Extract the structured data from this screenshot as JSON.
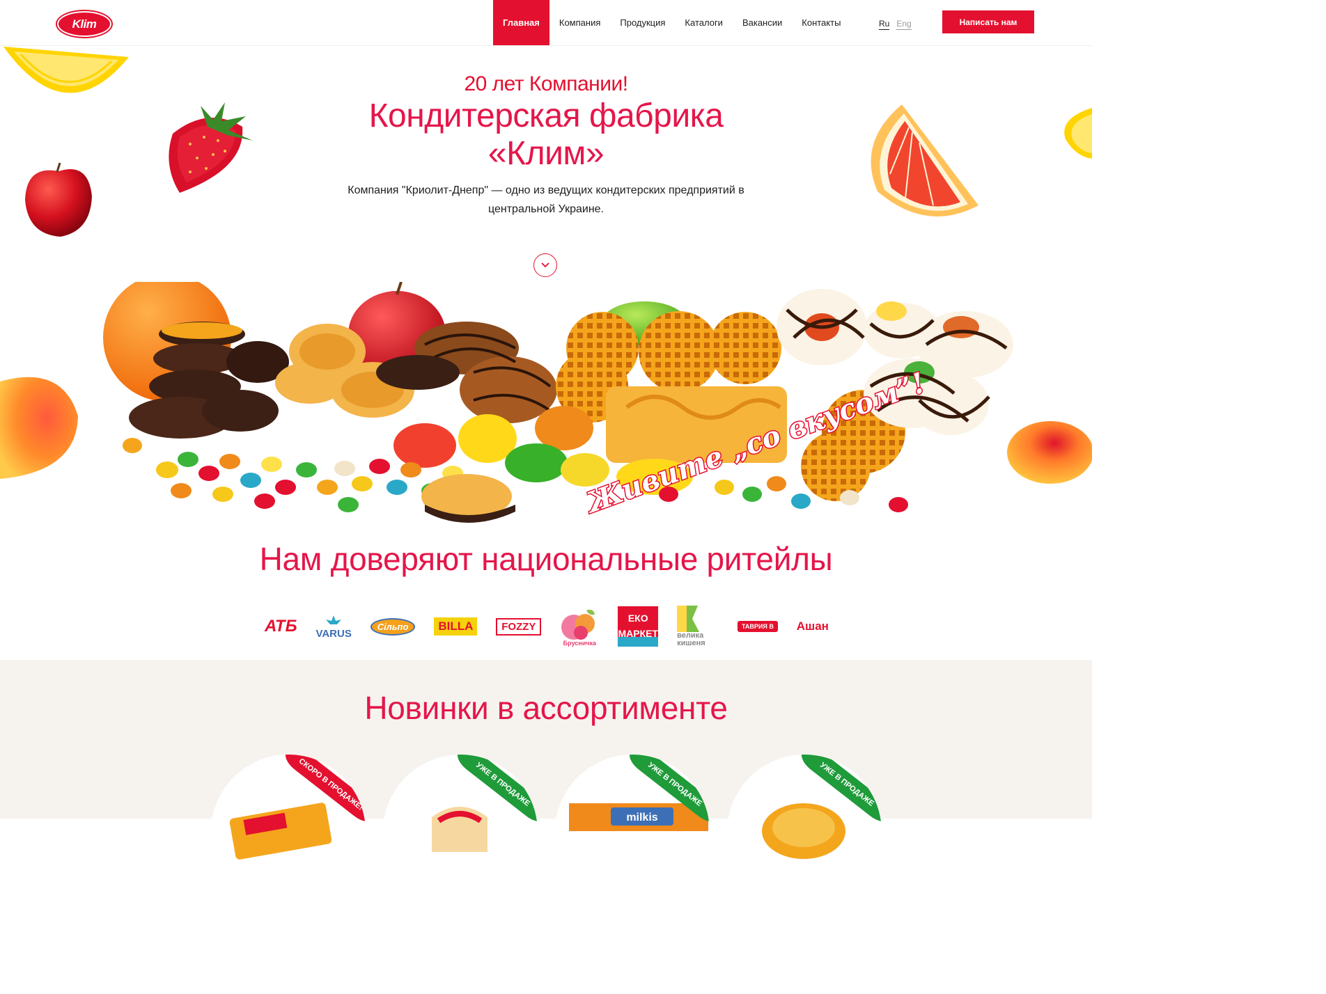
{
  "brand": {
    "logo_text": "Klim",
    "accent": "#e4102f"
  },
  "nav": {
    "items": [
      {
        "label": "Главная",
        "active": true
      },
      {
        "label": "Компания",
        "active": false
      },
      {
        "label": "Продукция",
        "active": false
      },
      {
        "label": "Каталоги",
        "active": false
      },
      {
        "label": "Вакансии",
        "active": false
      },
      {
        "label": "Контакты",
        "active": false
      }
    ]
  },
  "lang": {
    "ru": "Ru",
    "en": "Eng",
    "active": "Ru"
  },
  "header": {
    "cta_label": "Написать нам"
  },
  "hero": {
    "subtitle": "20 лет Компании!",
    "title": "Кондитерская фабрика «Клим»",
    "description": "Компания \"Криолит-Днепр\" — одно из ведущих кондитерских предприятий в центральной Украине.",
    "slogan": "Живите „со вкусом”!"
  },
  "retail": {
    "title": "Нам доверяют национальные ритейлы",
    "logos": [
      {
        "text": "АТБ",
        "color": "#e4102f",
        "icon": "atb-logo"
      },
      {
        "text": "VARUS",
        "color": "#3d6fb6",
        "icon": "varus-logo"
      },
      {
        "text": "Сільпо",
        "color": "#f4a11d",
        "icon": "silpo-logo"
      },
      {
        "text": "BILLA",
        "color": "#f5d20a",
        "icon": "billa-logo"
      },
      {
        "text": "FOZZY",
        "color": "#e4102f",
        "icon": "fozzy-logo"
      },
      {
        "text": "Брусничка",
        "color": "#e83f6f",
        "icon": "brusnichka-logo"
      },
      {
        "text": "ЕКО МАРКЕТ",
        "color": "#e4102f",
        "icon": "eko-market-logo"
      },
      {
        "text": "велика кишеня",
        "color": "#9bc53d",
        "icon": "velyka-kyshenya-logo"
      },
      {
        "text": "ТАВРИЯ В",
        "color": "#e4102f",
        "icon": "tavria-logo"
      },
      {
        "text": "Ашан",
        "color": "#e4102f",
        "icon": "auchan-logo"
      }
    ]
  },
  "new_products": {
    "title": "Новинки в ассортименте",
    "cards": [
      {
        "badge": "СКОРО В ПРОДАЖЕ!",
        "badge_color": "#e4102f"
      },
      {
        "badge": "УЖЕ В ПРОДАЖЕ",
        "badge_color": "#1f9b3a"
      },
      {
        "badge": "УЖЕ В ПРОДАЖЕ",
        "badge_color": "#1f9b3a"
      },
      {
        "badge": "УЖЕ В ПРОДАЖЕ",
        "badge_color": "#1f9b3a"
      }
    ]
  }
}
